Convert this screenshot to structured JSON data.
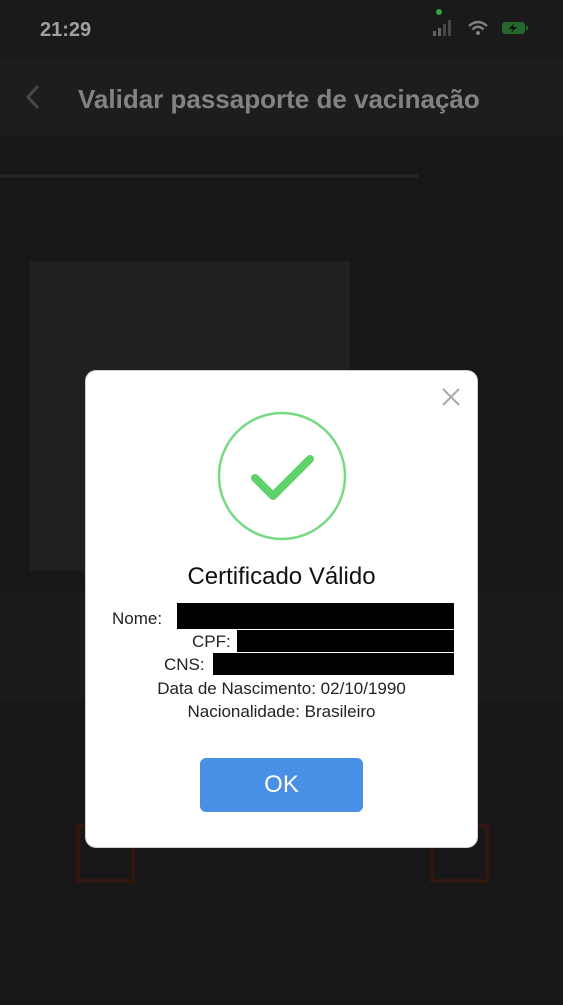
{
  "status_bar": {
    "time": "21:29"
  },
  "header": {
    "title": "Validar passaporte de vacinação"
  },
  "modal": {
    "title": "Certificado Válido",
    "name_label": "Nome:",
    "cpf_label": "CPF:",
    "cns_label": "CNS:",
    "birth_date": "Data de Nascimento: 02/10/1990",
    "nationality": "Nacionalidade: Brasileiro",
    "ok_label": "OK"
  },
  "colors": {
    "success": "#5fd16a",
    "primary": "#4a8fe6"
  }
}
